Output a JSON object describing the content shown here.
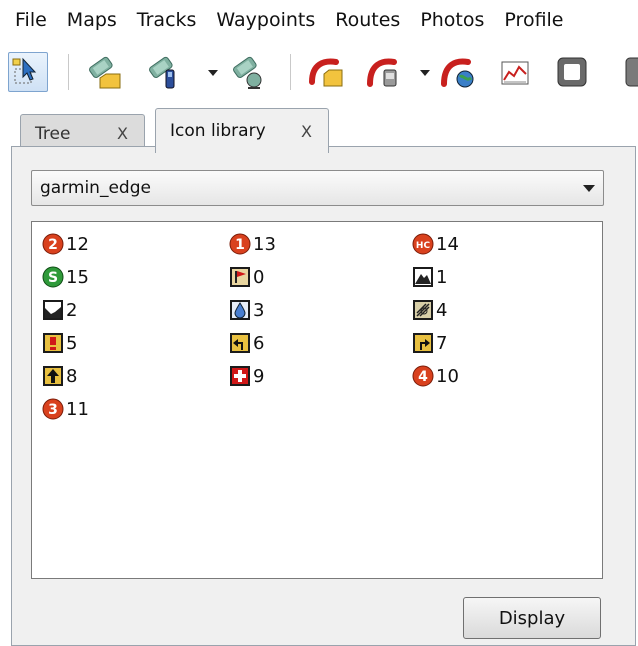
{
  "menu": [
    "File",
    "Maps",
    "Tracks",
    "Waypoints",
    "Routes",
    "Photos",
    "Profile"
  ],
  "toolbar": {
    "buttons": [
      {
        "name": "select-tool",
        "icon": "cursor-select-icon",
        "selected": true
      },
      {
        "name": "map-open",
        "icon": "map-folder-icon"
      },
      {
        "name": "map-import",
        "icon": "map-import-icon",
        "has_dropdown": true
      },
      {
        "name": "map-download",
        "icon": "map-download-icon"
      },
      {
        "name": "track-open",
        "icon": "track-folder-icon"
      },
      {
        "name": "track-import",
        "icon": "track-device-icon",
        "has_dropdown": true
      },
      {
        "name": "track-globe",
        "icon": "track-globe-icon"
      },
      {
        "name": "elevation-profile",
        "icon": "elevation-chart-icon"
      },
      {
        "name": "stop",
        "icon": "stop-icon"
      }
    ]
  },
  "tabs": [
    {
      "label": "Tree",
      "close": "X",
      "active": false
    },
    {
      "label": "Icon library",
      "close": "X",
      "active": true
    }
  ],
  "icon_set": {
    "selected": "garmin_edge"
  },
  "icons": [
    {
      "label": "12",
      "icon": "circle-2-icon"
    },
    {
      "label": "13",
      "icon": "circle-1-icon"
    },
    {
      "label": "14",
      "icon": "circle-hc-icon"
    },
    {
      "label": "15",
      "icon": "circle-s-icon"
    },
    {
      "label": "0",
      "icon": "flag-icon"
    },
    {
      "label": "1",
      "icon": "summit-icon"
    },
    {
      "label": "2",
      "icon": "valley-icon"
    },
    {
      "label": "3",
      "icon": "water-icon"
    },
    {
      "label": "4",
      "icon": "food-icon"
    },
    {
      "label": "5",
      "icon": "danger-icon"
    },
    {
      "label": "6",
      "icon": "left-turn-icon"
    },
    {
      "label": "7",
      "icon": "right-turn-icon"
    },
    {
      "label": "8",
      "icon": "straight-icon"
    },
    {
      "label": "9",
      "icon": "first-aid-icon"
    },
    {
      "label": "10",
      "icon": "circle-4-icon"
    },
    {
      "label": "11",
      "icon": "circle-3-icon"
    }
  ],
  "display_button": "Display",
  "colors": {
    "category_red": "#d9411e",
    "sprint_green": "#2f9a3a",
    "sign_yellow": "#e8c040",
    "water_blue": "#4a7fd0",
    "first_aid_red": "#d01818"
  }
}
